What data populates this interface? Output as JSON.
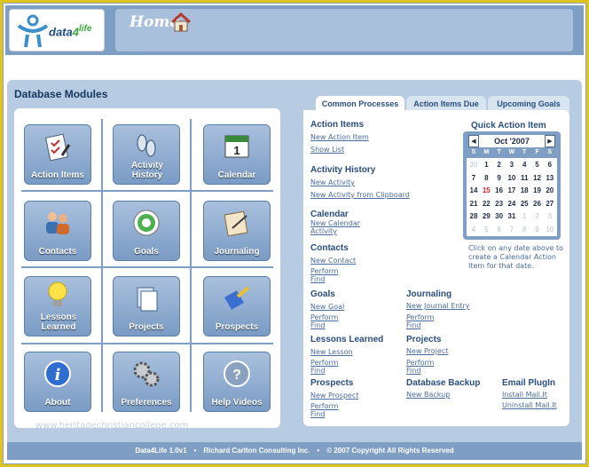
{
  "header": {
    "logo_prefix": "data",
    "logo_suffix": "4",
    "logo_life": "life",
    "home_title": "Home"
  },
  "modules": {
    "title": "Database Modules",
    "items": [
      {
        "label": "Action Items",
        "icon": "checklist-icon"
      },
      {
        "label": "Activity History",
        "icon": "footprints-icon"
      },
      {
        "label": "Calendar",
        "icon": "calendar-icon"
      },
      {
        "label": "Contacts",
        "icon": "people-icon"
      },
      {
        "label": "Goals",
        "icon": "target-icon"
      },
      {
        "label": "Journaling",
        "icon": "journal-icon"
      },
      {
        "label": "Lessons Learned",
        "icon": "lightbulb-icon"
      },
      {
        "label": "Projects",
        "icon": "documents-icon"
      },
      {
        "label": "Prospects",
        "icon": "brush-icon"
      },
      {
        "label": "About",
        "icon": "info-icon"
      },
      {
        "label": "Preferences",
        "icon": "gears-icon"
      },
      {
        "label": "Help Videos",
        "icon": "help-icon"
      }
    ]
  },
  "tabs": [
    {
      "label": "Common Processes",
      "active": true
    },
    {
      "label": "Action Items Due",
      "active": false
    },
    {
      "label": "Upcoming Goals",
      "active": false
    }
  ],
  "processes": {
    "action_items": {
      "title": "Action Items",
      "links": [
        "New Action Item",
        "Show List"
      ]
    },
    "activity_history": {
      "title": "Activity History",
      "links": [
        "New Activity",
        "New Activity from Clipboard"
      ]
    },
    "calendar": {
      "title": "Calendar",
      "links": [
        "New Calendar",
        "Activity"
      ]
    },
    "contacts": {
      "title": "Contacts",
      "links": [
        "New Contact",
        "Perform",
        "Find"
      ]
    },
    "goals": {
      "title": "Goals",
      "links": [
        "New Goal",
        "Perform",
        "Find"
      ]
    },
    "journaling": {
      "title": "Journaling",
      "links": [
        "New Journal Entry",
        "Perform",
        "Find"
      ]
    },
    "lessons_learned": {
      "title": "Lessons Learned",
      "links": [
        "New Lesson",
        "Perform",
        "Find"
      ]
    },
    "projects": {
      "title": "Projects",
      "links": [
        "New Project",
        "Perform",
        "Find"
      ]
    },
    "prospects": {
      "title": "Prospects",
      "links": [
        "New Prospect",
        "Perform",
        "Find"
      ]
    },
    "database_backup": {
      "title": "Database Backup",
      "links": [
        "New Backup"
      ]
    },
    "email_plugin": {
      "title": "Email PlugIn",
      "links": [
        "Install Mail.It",
        "Uninstall Mail.It"
      ]
    }
  },
  "quick_action": {
    "title": "Quick Action Item",
    "month": "Oct '2007",
    "prev": "◀",
    "next": "▶",
    "dow": [
      "S",
      "M",
      "T",
      "W",
      "T",
      "F",
      "S"
    ],
    "weeks": [
      [
        "30",
        "1",
        "2",
        "3",
        "4",
        "5",
        "6"
      ],
      [
        "7",
        "8",
        "9",
        "10",
        "11",
        "12",
        "13"
      ],
      [
        "14",
        "15",
        "16",
        "17",
        "18",
        "19",
        "20"
      ],
      [
        "21",
        "22",
        "23",
        "24",
        "25",
        "26",
        "27"
      ],
      [
        "28",
        "29",
        "30",
        "31",
        "1",
        "2",
        "3"
      ],
      [
        "4",
        "5",
        "6",
        "7",
        "8",
        "9",
        "10"
      ]
    ],
    "today": "15",
    "note": "Click on any date above to create a Calendar Action Item for that date."
  },
  "watermark": "www.heritagechristiancollege.com",
  "footer": {
    "version": "Data4Life 1.0v1",
    "company": "Richard Carlton Consulting Inc.",
    "copyright": "© 2007 Copyright All Rights Reserved"
  }
}
